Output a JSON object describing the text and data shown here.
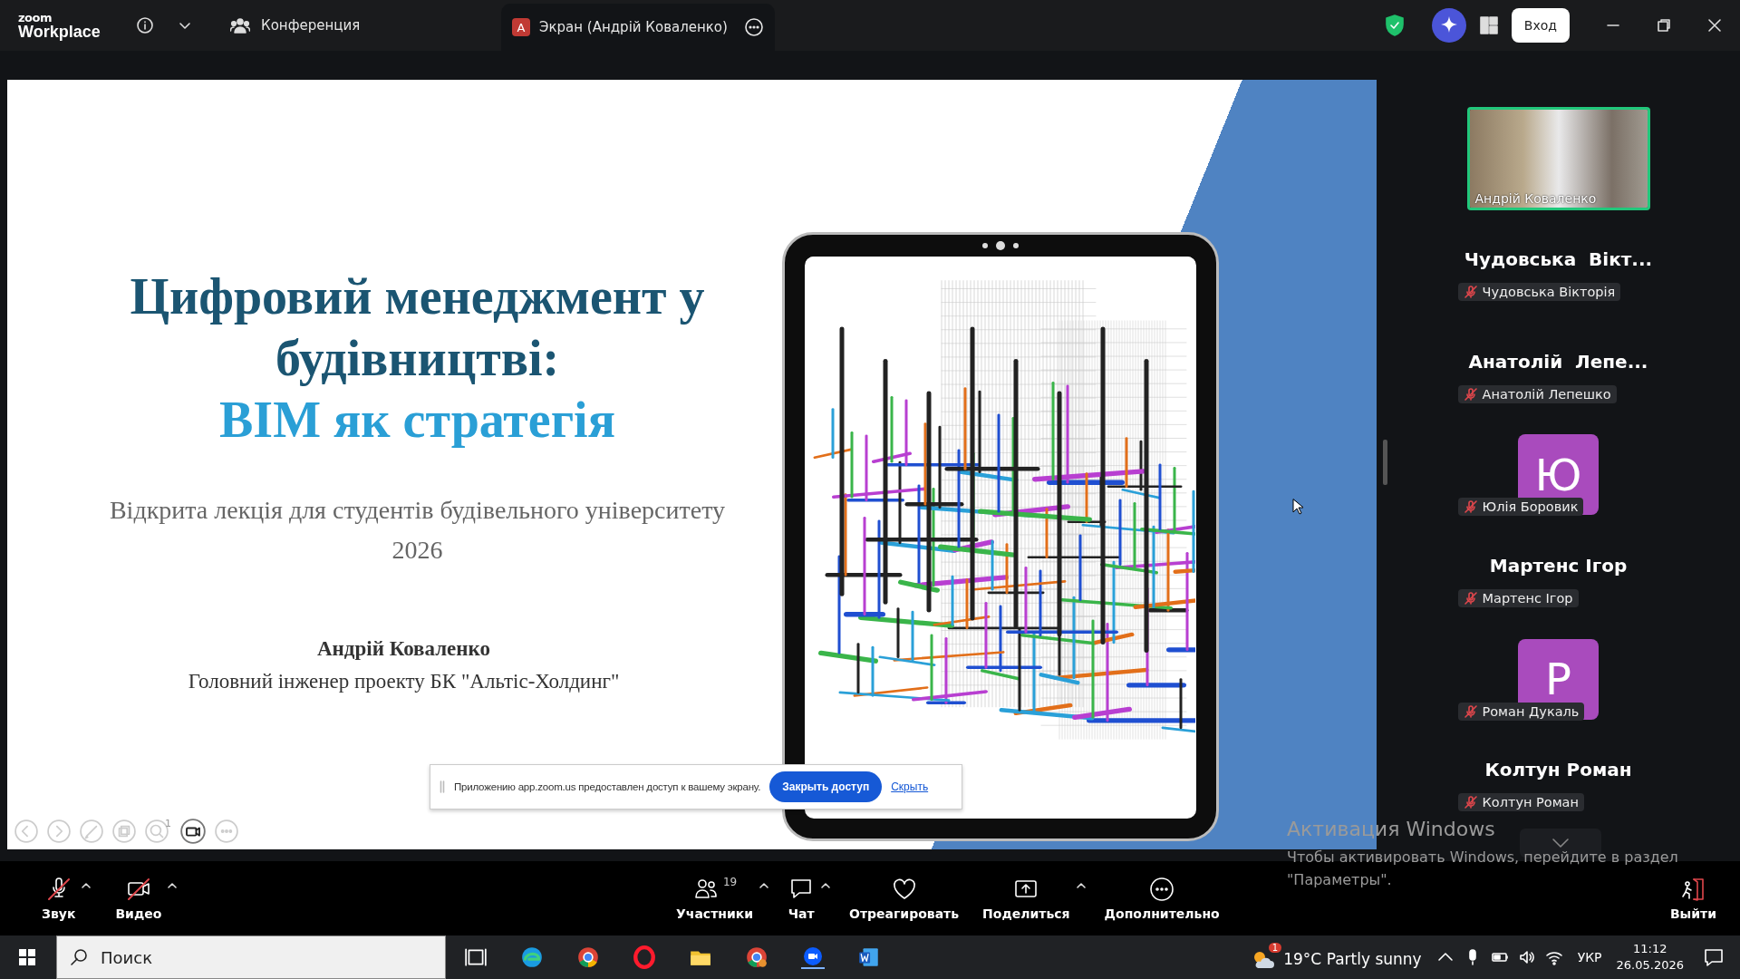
{
  "app": {
    "logo_top": "zoom",
    "logo_bottom": "Workplace"
  },
  "top_bar": {
    "meeting_tab": "Конференция",
    "share_badge": "A",
    "share_tab": "Экран (Андрій Коваленко)",
    "sign_in": "Вход"
  },
  "slide": {
    "title_lines": [
      "Цифровий менеджмент у",
      "будівництві:"
    ],
    "title_accent": "BIM як стратегія",
    "subtitle": "Відкрита лекція для студентів будівельного університету",
    "year": "2026",
    "author": "Андрій Коваленко",
    "author_role": "Головний інженер проекту БК \"Альтіс-Холдинг\"",
    "zoom_count": "1"
  },
  "share_notice": {
    "message": "Приложению app.zoom.us предоставлен доступ к вашему экрану.",
    "stop_button": "Закрыть доступ",
    "hide_link": "Скрыть"
  },
  "participants": [
    {
      "kind": "video",
      "name": "Андрій Коваленко",
      "muted": false
    },
    {
      "kind": "name",
      "title": "Чудовська  Вікт...",
      "name": "Чудовська Вікторія",
      "muted": true
    },
    {
      "kind": "name",
      "title": "Анатолій  Лепе...",
      "name": "Анатолій Лепешко",
      "muted": true
    },
    {
      "kind": "avatar",
      "initial": "Ю",
      "name": "Юлія Боровик",
      "muted": true
    },
    {
      "kind": "name",
      "title": "Мартенс Ігор",
      "name": "Мартенс Ігор",
      "muted": true
    },
    {
      "kind": "avatar",
      "initial": "Р",
      "name": "Роман Дукаль",
      "muted": true
    },
    {
      "kind": "name",
      "title": "Колтун Роман",
      "name": "Колтун Роман",
      "muted": true
    }
  ],
  "activation": {
    "title": "Активация Windows",
    "text": "Чтобы активировать Windows, перейдите в раздел \"Параметры\"."
  },
  "toolbar": [
    {
      "kind": "audio",
      "label": "Звук",
      "off": true,
      "caret": true
    },
    {
      "kind": "video",
      "label": "Видео",
      "off": true,
      "caret": true
    },
    {
      "kind": "participants",
      "label": "Участники",
      "count": "19",
      "caret": true
    },
    {
      "kind": "chat",
      "label": "Чат",
      "caret": true
    },
    {
      "kind": "react",
      "label": "Отреагировать",
      "caret": false
    },
    {
      "kind": "share",
      "label": "Поделиться",
      "caret": true
    },
    {
      "kind": "more",
      "label": "Дополнительно",
      "caret": false
    }
  ],
  "leave": "Выйти",
  "taskbar": {
    "search_placeholder": "Поиск",
    "weather": "19°C Partly sunny",
    "weather_badge": "1",
    "language": "УКР",
    "time": "11:12",
    "date": "26.05.2026"
  }
}
